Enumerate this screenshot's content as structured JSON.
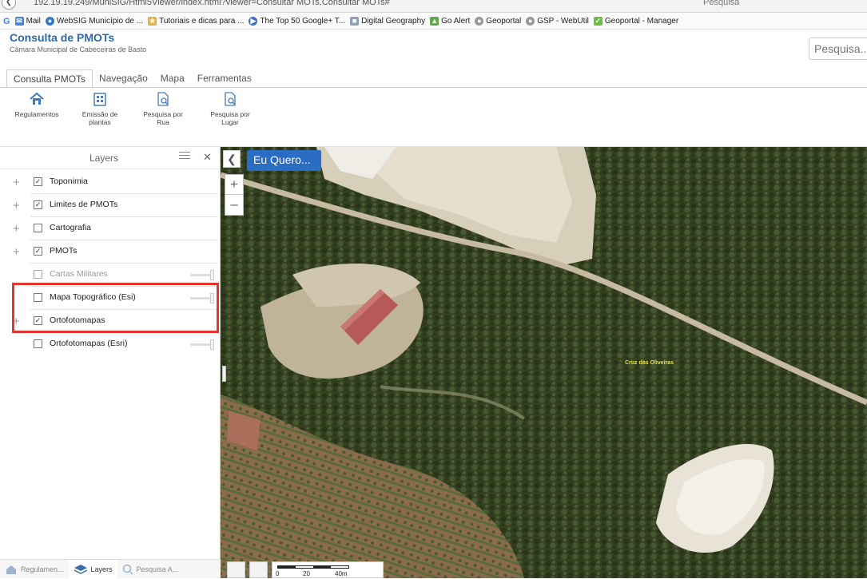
{
  "browser": {
    "url": "192.19.19.249/MuniSIG/Html5Viewer/index.html?viewer=Consultar MOTs.Consultar MOTs#",
    "search_placeholder": "Pesquisa"
  },
  "bookmarks": [
    {
      "label": "Mail",
      "icon": "mail-icon",
      "color": "#4a7fd6"
    },
    {
      "label": "WebSIG Município de ...",
      "icon": "globe-icon",
      "color": "#2f7ac9"
    },
    {
      "label": "Tutoriais e dicas para ...",
      "icon": "tutorial-icon",
      "color": "#e2b23b"
    },
    {
      "label": "The Top 50 Google+ T...",
      "icon": "video-icon",
      "color": "#3a6fc2"
    },
    {
      "label": "Digital Geography",
      "icon": "geography-icon",
      "color": "#8fa0b8"
    },
    {
      "label": "Go Alert",
      "icon": "alert-icon",
      "color": "#64a644"
    },
    {
      "label": "Geoportal",
      "icon": "geoportal-icon",
      "color": "#999999"
    },
    {
      "label": "GSP - WebUtil",
      "icon": "gsp-icon",
      "color": "#999999"
    },
    {
      "label": "Geoportal - Manager",
      "icon": "manager-icon",
      "color": "#6abf3b"
    }
  ],
  "header": {
    "title": "Consulta de PMOTs",
    "subtitle": "Câmara Municipal de Cabeceiras de Basto",
    "search_placeholder": "Pesquisa..."
  },
  "ribbon": {
    "tabs": [
      "Consulta PMOTs",
      "Navegação",
      "Mapa",
      "Ferramentas"
    ],
    "active_tab": "Consulta PMOTs",
    "tools": [
      {
        "line1": "Regulamentos",
        "line2": "",
        "icon": "home-icon"
      },
      {
        "line1": "Emissão de",
        "line2": "plantas",
        "icon": "building-icon"
      },
      {
        "line1": "Pesquisa por",
        "line2": "Rua",
        "icon": "search-street-icon"
      },
      {
        "line1": "Pesquisa por",
        "line2": "Lugar",
        "icon": "search-place-icon"
      }
    ]
  },
  "layers_panel": {
    "title": "Layers",
    "layers": [
      {
        "label": "Toponimia",
        "checked": true,
        "expandable": true,
        "dim": false,
        "slider": false
      },
      {
        "label": "Limites de PMOTs",
        "checked": true,
        "expandable": true,
        "dim": false,
        "slider": false
      },
      {
        "label": "Cartografia",
        "checked": false,
        "expandable": true,
        "dim": false,
        "slider": false
      },
      {
        "label": "PMOTs",
        "checked": true,
        "expandable": true,
        "dim": false,
        "slider": false
      },
      {
        "label": "Cartas Militares",
        "checked": false,
        "expandable": false,
        "dim": true,
        "slider": true
      },
      {
        "label": "Mapa Topográfico (Esi)",
        "checked": false,
        "expandable": false,
        "dim": false,
        "slider": true
      },
      {
        "label": "Ortofotomapas",
        "checked": true,
        "expandable": true,
        "dim": false,
        "slider": false
      },
      {
        "label": "Ortofotomapas (Esri)",
        "checked": false,
        "expandable": false,
        "dim": false,
        "slider": true
      }
    ],
    "footer_tabs": [
      {
        "label": "Regulamen...",
        "icon": "home-icon",
        "active": false
      },
      {
        "label": "Layers",
        "icon": "layers-icon",
        "active": true
      },
      {
        "label": "Pesquisa A...",
        "icon": "search-icon",
        "active": false
      }
    ]
  },
  "map": {
    "eu_quero_label": "Eu Quero...",
    "place_label": "Cruz das Oliveiras",
    "scale": {
      "ticks": [
        "0",
        "20",
        "40m"
      ]
    }
  },
  "colors": {
    "accent": "#2b6cc4",
    "title": "#2d6aa8",
    "highlight": "#e8342f"
  }
}
